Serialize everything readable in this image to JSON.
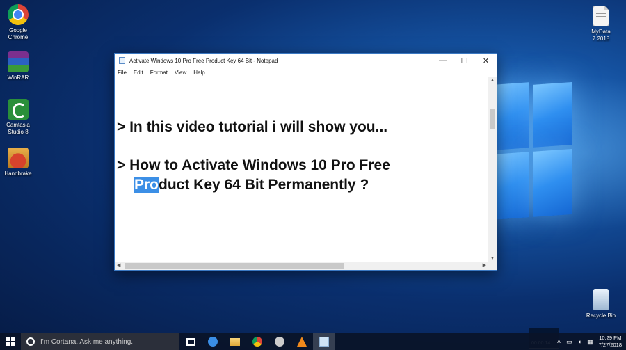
{
  "desktop": {
    "icons_left": [
      {
        "label": "Google Chrome",
        "icon": "chrome-icon"
      },
      {
        "label": "WinRAR",
        "icon": "winrar-icon"
      },
      {
        "label": "Camtasia Studio 8",
        "icon": "camtasia-icon"
      },
      {
        "label": "Handbrake",
        "icon": "handbrake-icon"
      }
    ],
    "mydata": {
      "label": "MyData 7.2018",
      "icon": "document-icon"
    },
    "recycle": {
      "label": "Recycle Bin",
      "icon": "recycle-bin-icon"
    }
  },
  "notepad": {
    "title": "Activate Windows 10 Pro Free Product Key 64 Bit - Notepad",
    "controls": {
      "minimize": "—",
      "maximize": "☐",
      "close": "✕"
    },
    "menu": [
      "File",
      "Edit",
      "Format",
      "View",
      "Help"
    ],
    "text": {
      "line1": "> In this video tutorial i will show you...",
      "line2": "> How to Activate Windows 10 Pro Free",
      "line3_selected": "Pro",
      "line3_rest": "duct Key 64 Bit Permanently ?"
    }
  },
  "taskbar": {
    "search_placeholder": "I'm Cortana. Ask me anything.",
    "pinned": [
      "task-view-icon",
      "edge-icon",
      "file-explorer-icon",
      "chrome-icon",
      "settings-icon",
      "vlc-icon",
      "notepad-icon"
    ],
    "recording_time": "00:00:14",
    "time": "10:29 PM",
    "date": "7/27/2018"
  },
  "colors": {
    "selection": "#3c8fe6",
    "window_border": "#3a78c2",
    "taskbar": "#0a1428"
  }
}
